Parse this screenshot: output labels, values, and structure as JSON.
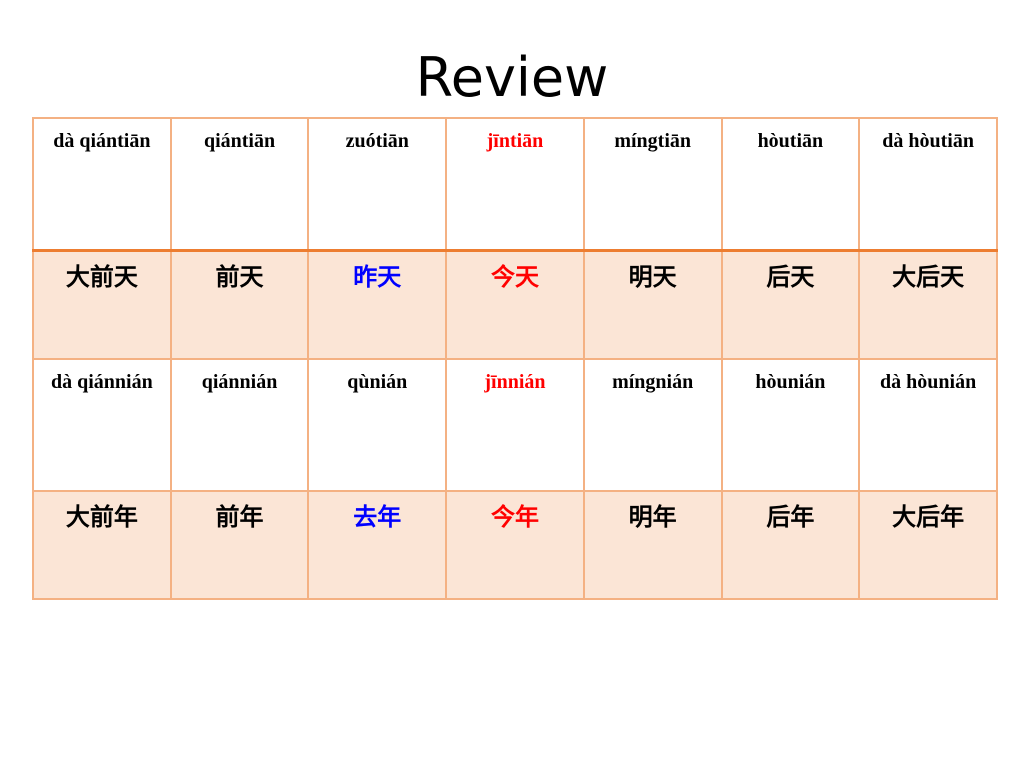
{
  "slide": {
    "title": "Review"
  },
  "colors": {
    "default": "#000000",
    "blue": "#0000FF",
    "red": "#FF0000"
  },
  "rows": [
    {
      "kind": "pinyin",
      "cells": [
        {
          "text": "dà qiántiān",
          "color": "default"
        },
        {
          "text": "qiántiān",
          "color": "default"
        },
        {
          "text": "zuótiān",
          "color": "default"
        },
        {
          "text": "jīntiān",
          "color": "red"
        },
        {
          "text": "míngtiān",
          "color": "default"
        },
        {
          "text": "hòutiān",
          "color": "default"
        },
        {
          "text": "dà hòutiān",
          "color": "default"
        }
      ]
    },
    {
      "kind": "hanzi",
      "cells": [
        {
          "text": "大前天",
          "color": "default"
        },
        {
          "text": "前天",
          "color": "default"
        },
        {
          "text": "昨天",
          "color": "blue"
        },
        {
          "text": "今天",
          "color": "red"
        },
        {
          "text": "明天",
          "color": "default"
        },
        {
          "text": "后天",
          "color": "default"
        },
        {
          "text": "大后天",
          "color": "default"
        }
      ]
    },
    {
      "kind": "pinyin",
      "cells": [
        {
          "text": "dà qiánnián",
          "color": "default"
        },
        {
          "text": "qiánnián",
          "color": "default"
        },
        {
          "text": "qùnián",
          "color": "default"
        },
        {
          "text": "jīnnián",
          "color": "red"
        },
        {
          "text": "míngnián",
          "color": "default"
        },
        {
          "text": "hòunián",
          "color": "default"
        },
        {
          "text": "dà hòunián",
          "color": "default"
        }
      ]
    },
    {
      "kind": "hanzi",
      "cells": [
        {
          "text": "大前年",
          "color": "default"
        },
        {
          "text": "前年",
          "color": "default"
        },
        {
          "text": "去年",
          "color": "blue"
        },
        {
          "text": "今年",
          "color": "red"
        },
        {
          "text": "明年",
          "color": "default"
        },
        {
          "text": "后年",
          "color": "default"
        },
        {
          "text": "大后年",
          "color": "default"
        }
      ]
    }
  ]
}
